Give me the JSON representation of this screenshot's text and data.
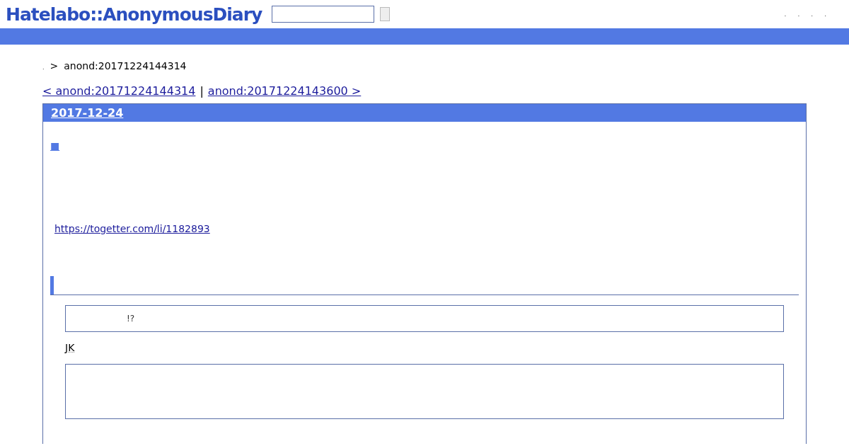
{
  "logo": "Hatelabo::AnonymousDiary",
  "header_links": [
    ".",
    ".",
    ".",
    "."
  ],
  "breadcrumb": {
    "home": ".",
    "separator": ">",
    "current": "anond:20171224144314"
  },
  "pager": {
    "prev": "< anond:20171224144314",
    "separator": "|",
    "next": "anond:20171224143600 >"
  },
  "entry": {
    "date": "2017-12-24",
    "title_mark": "■",
    "link": "https://togetter.com/li/1182893",
    "quote": "!?",
    "keyword": "JK"
  }
}
